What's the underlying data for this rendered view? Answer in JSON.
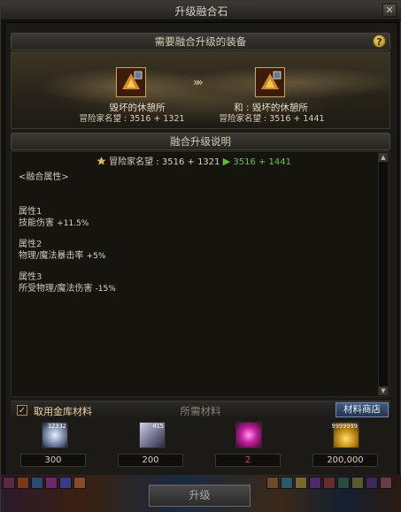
{
  "window": {
    "title": "升级融合石"
  },
  "equip_section": {
    "title": "需要融合升级的装备"
  },
  "items": [
    {
      "name": "毁坏的休憩所",
      "reputation": "冒险家名望 : 3516 + 1321"
    },
    {
      "name": "和 : 毁坏的休憩所",
      "reputation": "冒险家名望 : 3516 + 1441"
    }
  ],
  "arrows": "»»",
  "desc_section": {
    "title": "融合升级说明"
  },
  "rep_change": {
    "label": "冒险家名望 : 3516 + 1321",
    "arrow": "▶",
    "new_value": "3516 + 1441"
  },
  "description": {
    "heading": "<融合属性>",
    "attr1_label": "属性1",
    "attr1_name": "技能伤害",
    "attr1_value": "+11.5%",
    "attr2_label": "属性2",
    "attr2_name": "物理/魔法暴击率",
    "attr2_value": "+5%",
    "attr3_label": "属性3",
    "attr3_name": "所受物理/魔法伤害",
    "attr3_value": "-15%"
  },
  "materials": {
    "checkbox_label": "取用金库材料",
    "checked": true,
    "title": "所需材料",
    "shop_button": "材料商店",
    "slots": [
      {
        "icon": "crystal-icon",
        "stack": "32332",
        "qty": "300",
        "color": "#d8d0bc"
      },
      {
        "icon": "shard-icon",
        "stack": "415",
        "qty": "200",
        "color": "#d8d0bc"
      },
      {
        "icon": "magic-orb-icon",
        "stack": "",
        "qty": "2",
        "color": "#e04030"
      },
      {
        "icon": "gold-coins-icon",
        "stack": "9999999",
        "qty": "200,000",
        "color": "#d8d0bc"
      }
    ]
  },
  "actions": {
    "upgrade_button": "升级"
  }
}
